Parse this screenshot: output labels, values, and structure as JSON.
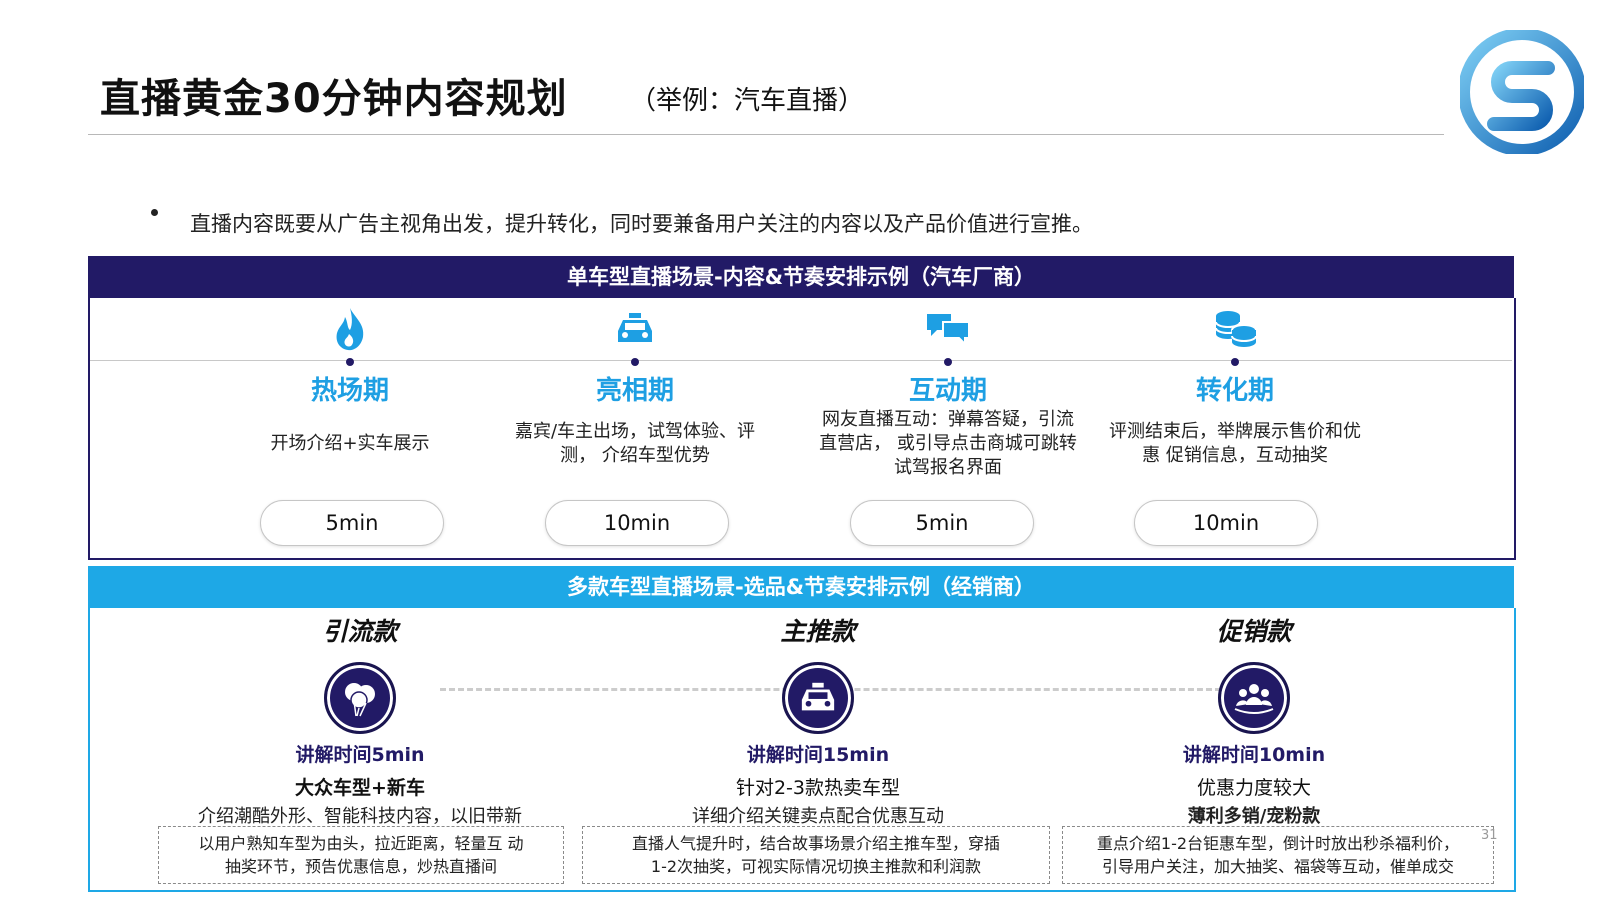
{
  "header": {
    "title": "直播黄金30分钟内容规划",
    "subtitle": "（举例：汽车直播）"
  },
  "bullet": "直播内容既要从广告主视角出发，提升转化，同时要兼备用户关注的内容以及产品价值进行宣推。",
  "section1": {
    "band_title": "单车型直播场景-内容&节奏安排示例（汽车厂商）",
    "stages": [
      {
        "icon": "flame-icon",
        "name": "热场期",
        "desc": "开场介绍+实车展示",
        "duration": "5min"
      },
      {
        "icon": "car-icon",
        "name": "亮相期",
        "desc": "嘉宾/车主出场，试驾体验、评测， 介绍车型优势",
        "duration": "10min"
      },
      {
        "icon": "chat-icon",
        "name": "互动期",
        "desc": "网友直播互动：弹幕答疑，引流直营店， 或引导点击商城可跳转试驾报名界面",
        "duration": "5min"
      },
      {
        "icon": "coins-icon",
        "name": "转化期",
        "desc": "评测结束后，举牌展示售价和优惠 促销信息，互动抽奖",
        "duration": "10min"
      }
    ]
  },
  "section2": {
    "band_title": "多款车型直播场景-选品&节奏安排示例（经销商）",
    "columns": [
      {
        "icon": "balloon-icon",
        "title": "引流款",
        "time": "讲解时间5min",
        "line1": "大众车型+新车",
        "line2": "介绍潮酷外形、智能科技内容，以旧带新",
        "note": [
          "以用户熟知车型为由头，拉近距离，轻量互 动",
          "抽奖环节，预告优惠信息，炒热直播间"
        ]
      },
      {
        "icon": "car-icon",
        "title": "主推款",
        "time": "讲解时间15min",
        "line1": "针对2-3款热卖车型",
        "line2": "详细介绍关键卖点配合优惠互动",
        "note": [
          "直播人气提升时，结合故事场景介绍主推车型，穿插",
          "1-2次抽奖，可视实际情况切换主推款和利润款"
        ]
      },
      {
        "icon": "crowd-icon",
        "title": "促销款",
        "time": "讲解时间10min",
        "line1": "优惠力度较大",
        "line2": "薄利多销/宠粉款",
        "note": [
          "重点介绍1-2台钜惠车型，倒计时放出秒杀福利价，",
          "引导用户关注，加大抽奖、福袋等互动，催单成交"
        ]
      }
    ]
  },
  "page_number": "31",
  "colors": {
    "navy": "#221a66",
    "sky": "#1ea8e6",
    "stage_name": "#1e9fe3"
  }
}
